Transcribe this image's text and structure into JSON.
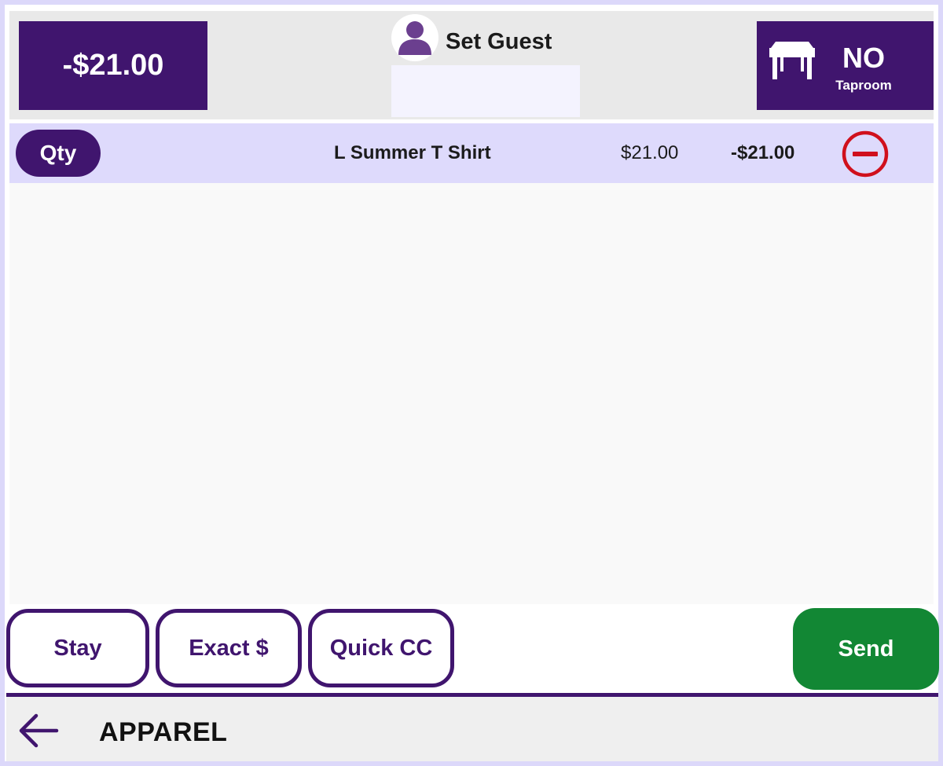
{
  "header": {
    "total": "-$21.00",
    "guest_label": "Set Guest",
    "guest_input_value": "",
    "table_number": "NO",
    "table_area": "Taproom"
  },
  "order": {
    "rows": [
      {
        "qty_label": "Qty",
        "name": "L Summer T Shirt",
        "price": "$21.00",
        "total": "-$21.00"
      }
    ]
  },
  "actions": {
    "stay": "Stay",
    "exact": "Exact $",
    "quick_cc": "Quick CC",
    "send": "Send"
  },
  "footer": {
    "category": "APPAREL"
  },
  "colors": {
    "brand_purple": "#40156e",
    "send_green": "#128734",
    "remove_red": "#d0101c",
    "row_highlight": "#dedafc",
    "avatar_purple": "#6b3f8f"
  },
  "icons": {
    "guest": "user-icon",
    "table": "table-icon",
    "remove": "minus-circle-icon",
    "back": "arrow-left-icon"
  }
}
